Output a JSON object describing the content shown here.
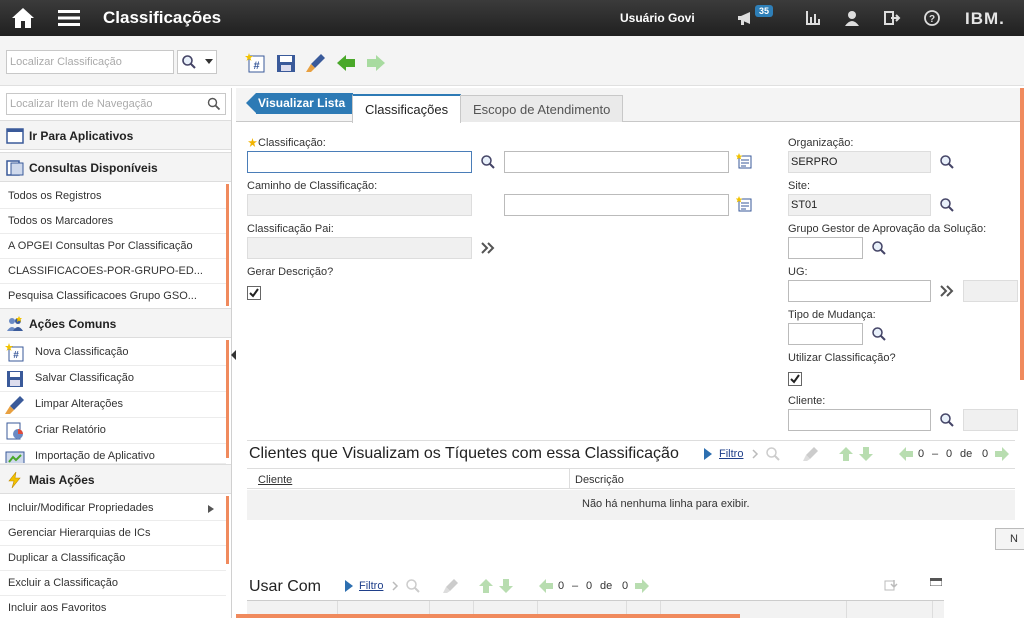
{
  "header": {
    "title": "Classificações",
    "user": "Usuário Govi",
    "notification_count": "35",
    "brand": "IBM.",
    "icons": [
      "home-icon",
      "menu-icon",
      "megaphone-icon",
      "chart-icon",
      "person-icon",
      "logout-icon",
      "help-icon"
    ]
  },
  "toolbar": {
    "search_placeholder": "Localizar Classificação",
    "buttons": [
      "new-icon",
      "save-icon",
      "clear-icon",
      "back-arrow-icon",
      "forward-arrow-icon"
    ]
  },
  "sidebar": {
    "search_placeholder": "Localizar Item de Navegação",
    "go_to_apps": "Ir Para Aplicativos",
    "queries_header": "Consultas Disponíveis",
    "queries": [
      "Todos os Registros",
      "Todos os Marcadores",
      "A OPGEI Consultas Por Classificação",
      "CLASSIFICACOES-POR-GRUPO-ED...",
      "Pesquisa Classificacoes Grupo GSO..."
    ],
    "common_header": "Ações Comuns",
    "common": [
      "Nova Classificação",
      "Salvar Classificação",
      "Limpar Alterações",
      "Criar Relatório",
      "Importação de Aplicativo"
    ],
    "more_header": "Mais Ações",
    "more": [
      "Incluir/Modificar Propriedades",
      "Gerenciar Hierarquias de ICs",
      "Duplicar a Classificação",
      "Excluir a Classificação",
      "Incluir aos Favoritos"
    ]
  },
  "tabs": {
    "list_button": "Visualizar Lista",
    "items": [
      "Classificações",
      "Escopo de Atendimento"
    ]
  },
  "form": {
    "classificacao_label": "Classificação:",
    "caminho_label": "Caminho de Classificação:",
    "pai_label": "Classificação Pai:",
    "gerar_label": "Gerar Descrição?",
    "organizacao_label": "Organização:",
    "organizacao_value": "SERPRO",
    "site_label": "Site:",
    "site_value": "ST01",
    "grupo_label": "Grupo Gestor de Aprovação da Solução:",
    "ug_label": "UG:",
    "tipo_label": "Tipo de Mudança:",
    "utilizar_label": "Utilizar Classificação?",
    "cliente_label": "Cliente:"
  },
  "clients_table": {
    "title": "Clientes que Visualizam os Tíquetes com essa Classificação",
    "filter": "Filtro",
    "pager_from": "0",
    "pager_dash": "–",
    "pager_to": "0",
    "pager_of": "de",
    "pager_total": "0",
    "col_client": "Cliente",
    "col_desc": "Descrição",
    "empty": "Não há nenhuma linha para exibir.",
    "new_row_partial": "N"
  },
  "usar_com": {
    "title": "Usar Com",
    "filter": "Filtro",
    "pager_from": "0",
    "pager_dash": "–",
    "pager_to": "0",
    "pager_of": "de",
    "pager_total": "0"
  }
}
